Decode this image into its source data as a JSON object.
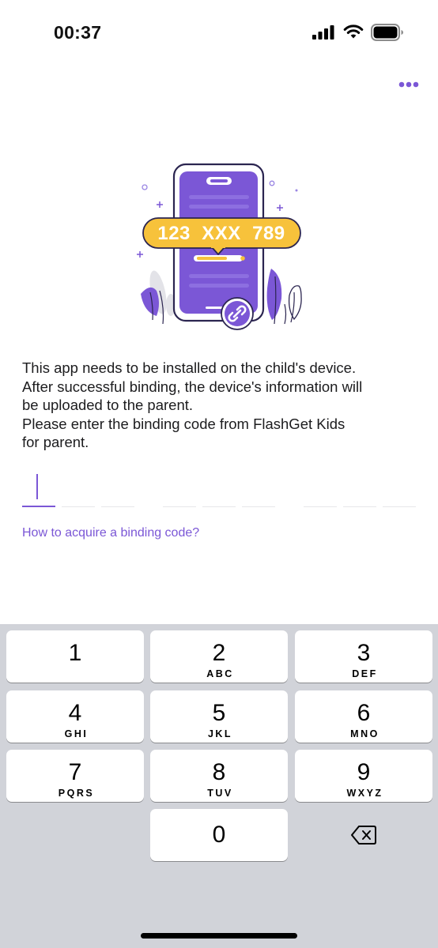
{
  "status_bar": {
    "time": "00:37"
  },
  "header": {
    "more_icon": "more-dots-icon"
  },
  "illustration": {
    "code_badge": "123  XXX  789",
    "link_icon": "link-icon"
  },
  "description": {
    "line1": "This app needs to be installed on the child's device.",
    "line2": "After successful binding, the device's information will",
    "line3": "be uploaded to the parent.",
    "line4": "Please enter the binding code from FlashGet Kids",
    "line5": "for parent."
  },
  "binding_code": {
    "slot_count": 9,
    "entered": ""
  },
  "help_link": "How to acquire a binding code?",
  "keypad": {
    "keys": [
      {
        "num": "1",
        "letters": ""
      },
      {
        "num": "2",
        "letters": "ABC"
      },
      {
        "num": "3",
        "letters": "DEF"
      },
      {
        "num": "4",
        "letters": "GHI"
      },
      {
        "num": "5",
        "letters": "JKL"
      },
      {
        "num": "6",
        "letters": "MNO"
      },
      {
        "num": "7",
        "letters": "PQRS"
      },
      {
        "num": "8",
        "letters": "TUV"
      },
      {
        "num": "9",
        "letters": "WXYZ"
      },
      {
        "num": "0",
        "letters": ""
      }
    ],
    "delete_icon": "backspace-icon"
  },
  "colors": {
    "accent": "#7b57d6",
    "badge": "#f7c23b",
    "keyboard_bg": "#d1d3d9"
  }
}
